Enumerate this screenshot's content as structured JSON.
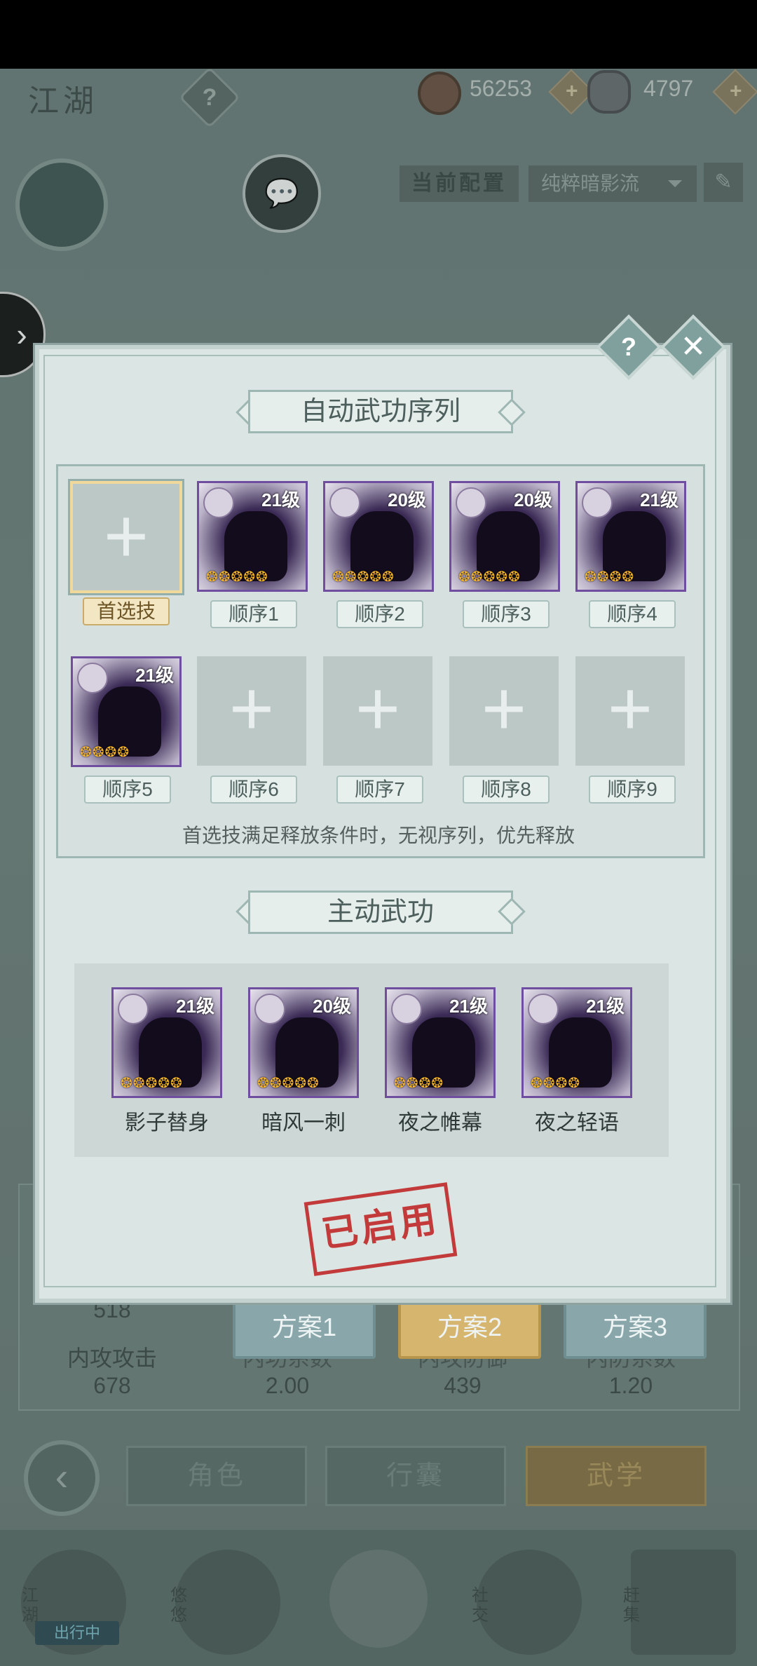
{
  "top": {
    "title": "江湖",
    "help": "?",
    "copper": "56253",
    "silver": "4797",
    "plus": "+"
  },
  "config": {
    "label": "当前配置",
    "selected": "纯粹暗影流",
    "chevron": "⏷",
    "edit": "✎"
  },
  "chat_icon": "💬",
  "side_arrow": "›",
  "modal": {
    "help": "?",
    "close": "✕",
    "auto_title": "自动武功序列",
    "active_title": "主动武功",
    "hint": "首选技满足释放条件时，无视序列，优先释放",
    "stamp": "已启用",
    "primary_label": "首选技",
    "slots": [
      {
        "label": "顺序1",
        "level": "21级",
        "stars": "❂❂❂❂❂"
      },
      {
        "label": "顺序2",
        "level": "20级",
        "stars": "❂❂❂❂❂"
      },
      {
        "label": "顺序3",
        "level": "20级",
        "stars": "❂❂❂❂❂"
      },
      {
        "label": "顺序4",
        "level": "21级",
        "stars": "❂❂❂❂"
      },
      {
        "label": "顺序5",
        "level": "21级",
        "stars": "❂❂❂❂"
      },
      {
        "label": "顺序6"
      },
      {
        "label": "顺序7"
      },
      {
        "label": "顺序8"
      },
      {
        "label": "顺序9"
      }
    ],
    "active_skills": [
      {
        "name": "影子替身",
        "level": "21级",
        "stars": "❂❂❂❂❂"
      },
      {
        "name": "暗风一刺",
        "level": "20级",
        "stars": "❂❂❂❂❂"
      },
      {
        "name": "夜之帷幕",
        "level": "21级",
        "stars": "❂❂❂❂"
      },
      {
        "name": "夜之轻语",
        "level": "21级",
        "stars": "❂❂❂❂"
      }
    ]
  },
  "stats": {
    "top_value": "518",
    "inner_attack_label": "内攻攻击",
    "inner_attack_value": "678",
    "coef_label": "内功系数",
    "coef_value": "2.00",
    "inner_def_label": "内攻防御",
    "inner_def_value": "439",
    "def_coef_label": "内防系数",
    "def_coef_value": "1.20"
  },
  "schemes": [
    "方案1",
    "方案2",
    "方案3"
  ],
  "nav": {
    "back": "‹",
    "tabs": [
      "角色",
      "行囊",
      "武学"
    ]
  },
  "dock": {
    "items": [
      "江湖",
      "悠悠",
      "社交",
      "赶集"
    ],
    "status": "出行中"
  }
}
